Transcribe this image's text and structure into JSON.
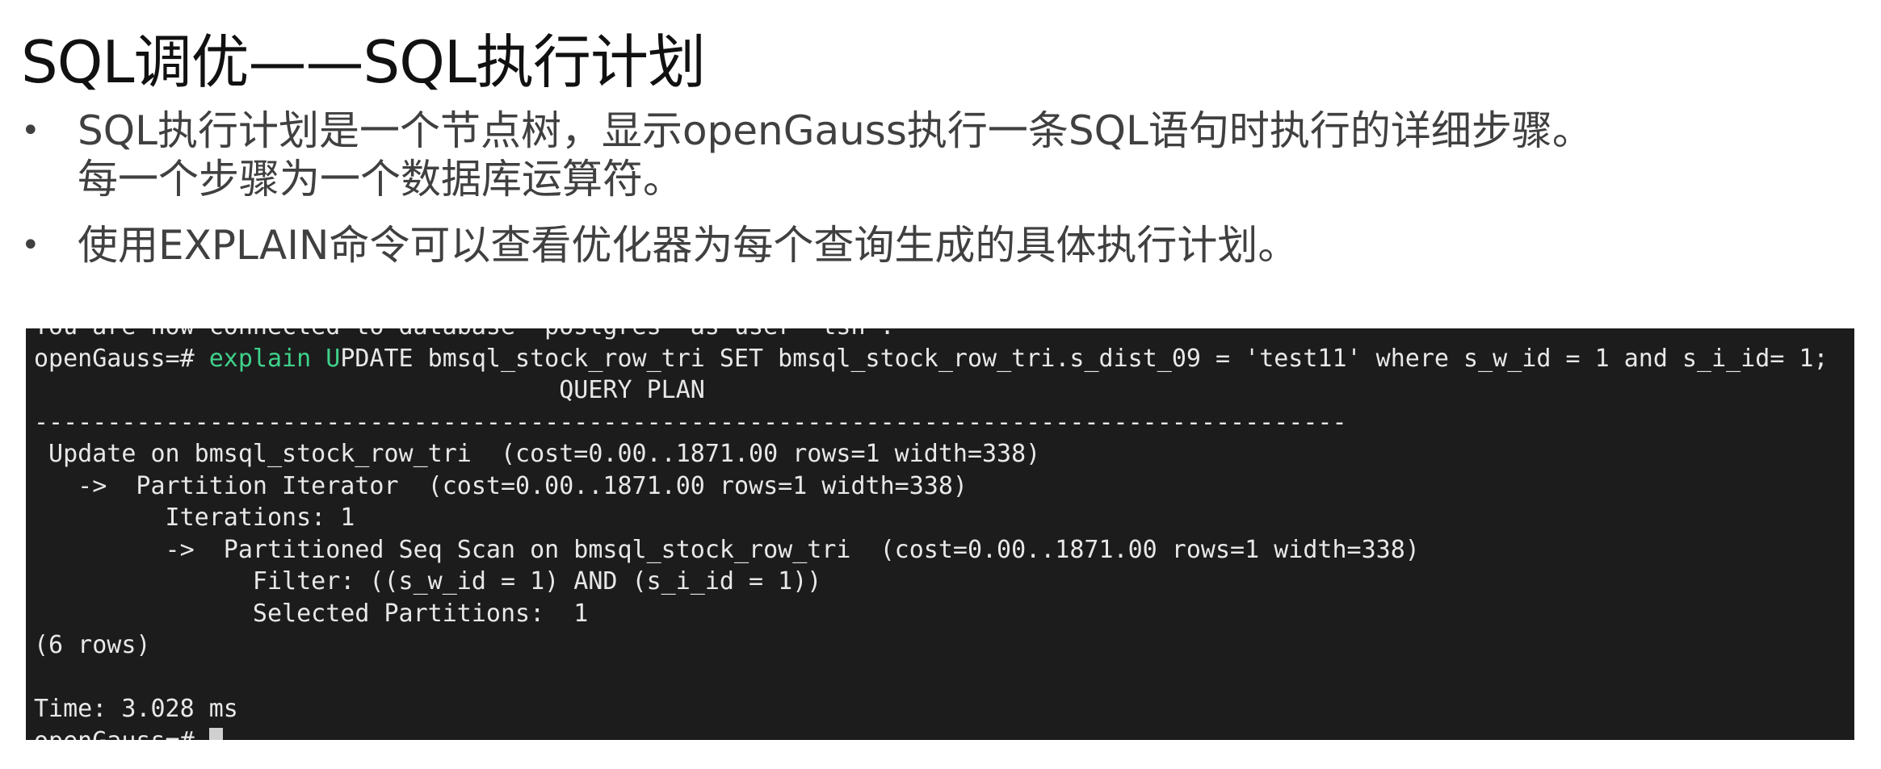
{
  "slide": {
    "title": "SQL调优——SQL执行计划",
    "bullets": [
      {
        "marker": "•",
        "text": "SQL执行计划是一个节点树，显示openGauss执行一条SQL语句时执行的详细步骤。每一个步骤为一个数据库运算符。"
      },
      {
        "marker": "•",
        "text": "使用EXPLAIN命令可以查看优化器为每个查询生成的具体执行计划。"
      }
    ]
  },
  "terminal": {
    "top_line": "You are now connected to database \"postgres\" as user \"tsh\".",
    "prompt": "openGauss=# ",
    "cmd_keyword": "explain U",
    "cmd_rest": "PDATE bmsql_stock_row_tri SET bmsql_stock_row_tri.s_dist_09 = 'test11' where s_w_id = 1 and s_i_id= 1;",
    "plan_header": "                                    QUERY PLAN",
    "separator": "------------------------------------------------------------------------------------------",
    "plan_lines": [
      " Update on bmsql_stock_row_tri  (cost=0.00..1871.00 rows=1 width=338)",
      "   ->  Partition Iterator  (cost=0.00..1871.00 rows=1 width=338)",
      "         Iterations: 1",
      "         ->  Partitioned Seq Scan on bmsql_stock_row_tri  (cost=0.00..1871.00 rows=1 width=338)",
      "               Filter: ((s_w_id = 1) AND (s_i_id = 1))",
      "               Selected Partitions:  1"
    ],
    "row_count": "(6 rows)",
    "blank": "",
    "timing": "Time: 3.028 ms",
    "last_prompt": "openGauss=# "
  }
}
